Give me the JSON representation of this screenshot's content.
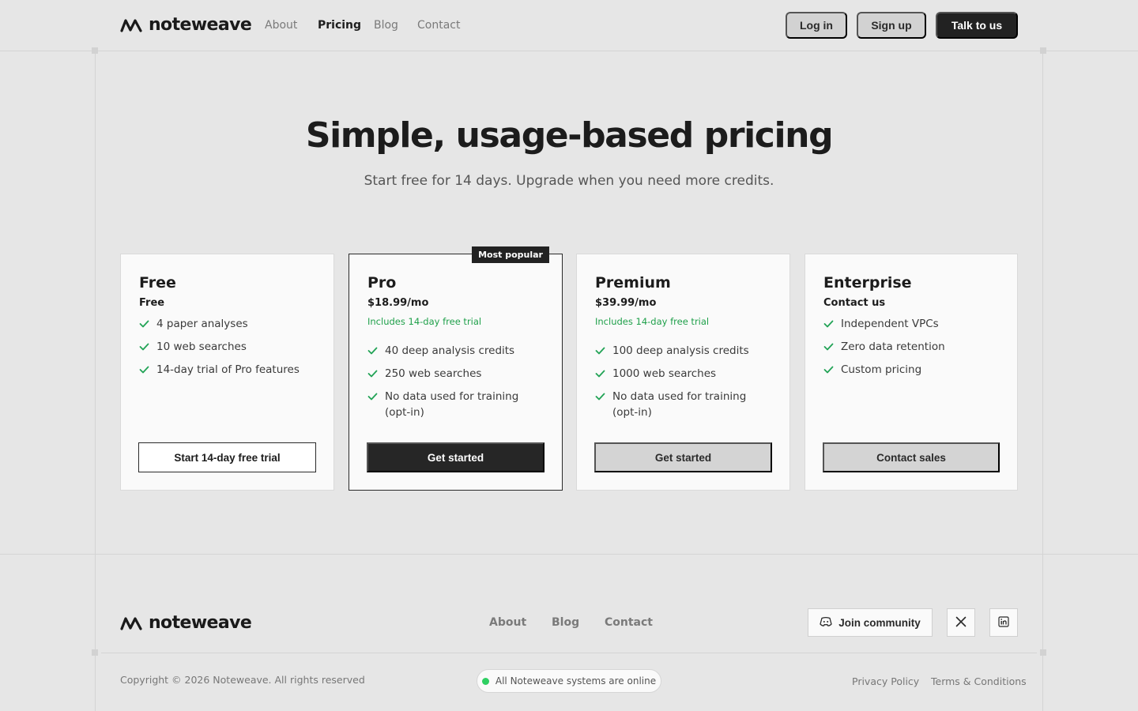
{
  "brand": {
    "name": "noteweave"
  },
  "nav": {
    "links": [
      "About",
      "Pricing",
      "Blog",
      "Contact"
    ],
    "login": "Log in",
    "signup": "Sign up",
    "talk": "Talk to us"
  },
  "hero": {
    "title": "Simple, usage-based pricing",
    "subtitle": "Start free for 14 days. Upgrade when you need more credits."
  },
  "plans": [
    {
      "name": "Free",
      "price": "Free",
      "trial": "",
      "features": [
        "4 paper analyses",
        "10 web searches",
        "14-day trial of Pro features"
      ],
      "cta": "Start 14-day free trial"
    },
    {
      "name": "Pro",
      "price": "$18.99/mo",
      "trial": "Includes 14-day free trial",
      "badge": "Most popular",
      "features": [
        "40 deep analysis credits",
        "250 web searches",
        "No data used for training (opt-in)"
      ],
      "cta": "Get started"
    },
    {
      "name": "Premium",
      "price": "$39.99/mo",
      "trial": "Includes 14-day free trial",
      "features": [
        "100 deep analysis credits",
        "1000 web searches",
        "No data used for training (opt-in)"
      ],
      "cta": "Get started"
    },
    {
      "name": "Enterprise",
      "price": "Contact us",
      "trial": "",
      "features": [
        "Independent VPCs",
        "Zero data retention",
        "Custom pricing"
      ],
      "cta": "Contact sales"
    }
  ],
  "footer": {
    "links": [
      "About",
      "Blog",
      "Contact"
    ],
    "community": "Join community",
    "copyright": "Copyright © 2026 Noteweave. All rights reserved",
    "status": "All Noteweave systems are online",
    "privacy": "Privacy Policy",
    "terms": "Terms & Conditions"
  },
  "colors": {
    "background": "#e6e6e6",
    "accent_dark": "#222222",
    "trial_green": "#1fa04a",
    "check_green": "#22a356",
    "status_green": "#2fcf62"
  },
  "icons": {
    "logo": "wave-logo-icon",
    "check": "check-icon",
    "community": "discord-icon",
    "x": "x-twitter-icon",
    "linkedin": "linkedin-icon"
  }
}
